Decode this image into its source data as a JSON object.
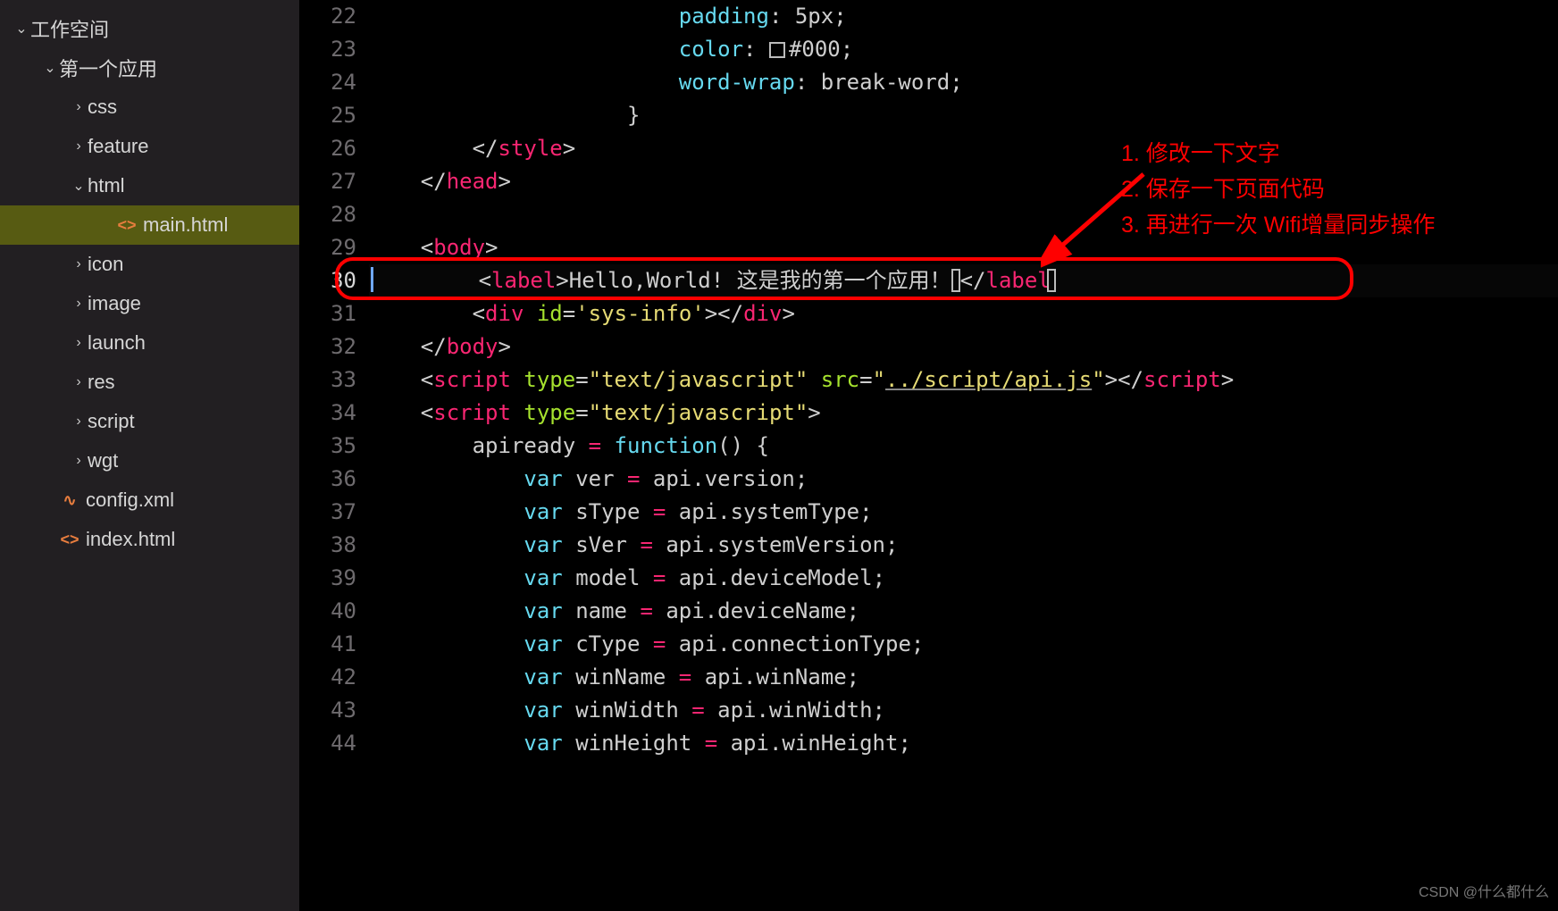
{
  "sidebar": {
    "root_label": "工作空间",
    "nodes": [
      {
        "label": "第一个应用",
        "depth": 1,
        "chev": "down",
        "icon": ""
      },
      {
        "label": "css",
        "depth": 2,
        "chev": "right",
        "icon": ""
      },
      {
        "label": "feature",
        "depth": 2,
        "chev": "right",
        "icon": ""
      },
      {
        "label": "html",
        "depth": 2,
        "chev": "down",
        "icon": ""
      },
      {
        "label": "main.html",
        "depth": 3,
        "chev": "",
        "icon": "code",
        "active": true
      },
      {
        "label": "icon",
        "depth": 2,
        "chev": "right",
        "icon": ""
      },
      {
        "label": "image",
        "depth": 2,
        "chev": "right",
        "icon": ""
      },
      {
        "label": "launch",
        "depth": 2,
        "chev": "right",
        "icon": ""
      },
      {
        "label": "res",
        "depth": 2,
        "chev": "right",
        "icon": ""
      },
      {
        "label": "script",
        "depth": 2,
        "chev": "right",
        "icon": ""
      },
      {
        "label": "wgt",
        "depth": 2,
        "chev": "right",
        "icon": ""
      },
      {
        "label": "config.xml",
        "depth": 1,
        "chev": "",
        "icon": "rss"
      },
      {
        "label": "index.html",
        "depth": 1,
        "chev": "",
        "icon": "code"
      }
    ]
  },
  "editor": {
    "first_line": 22,
    "current_line": 30,
    "lines": [
      {
        "n": 22,
        "ind": 6,
        "seg": [
          [
            "prop",
            "padding"
          ],
          [
            "pun",
            ": "
          ],
          [
            "val",
            "5px"
          ],
          [
            "pun",
            ";"
          ]
        ]
      },
      {
        "n": 23,
        "ind": 6,
        "seg": [
          [
            "prop",
            "color"
          ],
          [
            "pun",
            ": "
          ],
          [
            "swatch",
            ""
          ],
          [
            "val",
            "#000"
          ],
          [
            "pun",
            ";"
          ]
        ]
      },
      {
        "n": 24,
        "ind": 6,
        "seg": [
          [
            "prop",
            "word-wrap"
          ],
          [
            "pun",
            ": "
          ],
          [
            "val",
            "break-word"
          ],
          [
            "pun",
            ";"
          ]
        ]
      },
      {
        "n": 25,
        "ind": 5,
        "seg": [
          [
            "pun",
            "}"
          ]
        ]
      },
      {
        "n": 26,
        "ind": 2,
        "seg": [
          [
            "ang",
            "</"
          ],
          [
            "tag",
            "style"
          ],
          [
            "ang",
            ">"
          ]
        ]
      },
      {
        "n": 27,
        "ind": 1,
        "seg": [
          [
            "ang",
            "</"
          ],
          [
            "tag",
            "head"
          ],
          [
            "ang",
            ">"
          ]
        ]
      },
      {
        "n": 28,
        "ind": 0,
        "seg": []
      },
      {
        "n": 29,
        "ind": 1,
        "seg": [
          [
            "ang",
            "<"
          ],
          [
            "tag",
            "body"
          ],
          [
            "ang",
            ">"
          ]
        ]
      },
      {
        "n": 30,
        "ind": 2,
        "seg": [
          [
            "ang",
            "<"
          ],
          [
            "tag",
            "label"
          ],
          [
            "ang",
            ">"
          ],
          [
            "txt",
            "Hello,World! 这是我的第一个应用！"
          ],
          [
            "ghost",
            ""
          ],
          [
            "ang",
            "</"
          ],
          [
            "tag",
            "label"
          ],
          [
            "ghost2",
            ""
          ]
        ]
      },
      {
        "n": 31,
        "ind": 2,
        "seg": [
          [
            "ang",
            "<"
          ],
          [
            "tag",
            "div"
          ],
          [
            "pun",
            " "
          ],
          [
            "attr",
            "id"
          ],
          [
            "pun",
            "="
          ],
          [
            "str",
            "'sys-info'"
          ],
          [
            "ang",
            "></"
          ],
          [
            "tag",
            "div"
          ],
          [
            "ang",
            ">"
          ]
        ]
      },
      {
        "n": 32,
        "ind": 1,
        "seg": [
          [
            "ang",
            "</"
          ],
          [
            "tag",
            "body"
          ],
          [
            "ang",
            ">"
          ]
        ]
      },
      {
        "n": 33,
        "ind": 1,
        "seg": [
          [
            "ang",
            "<"
          ],
          [
            "tag",
            "script"
          ],
          [
            "pun",
            " "
          ],
          [
            "attr",
            "type"
          ],
          [
            "pun",
            "="
          ],
          [
            "str",
            "\"text/javascript\""
          ],
          [
            "pun",
            " "
          ],
          [
            "attr",
            "src"
          ],
          [
            "pun",
            "="
          ],
          [
            "srcq",
            "\""
          ],
          [
            "src",
            "../script/api.js"
          ],
          [
            "srcq",
            "\""
          ],
          [
            "ang",
            "></"
          ],
          [
            "tag",
            "script"
          ],
          [
            "ang",
            ">"
          ]
        ]
      },
      {
        "n": 34,
        "ind": 1,
        "seg": [
          [
            "ang",
            "<"
          ],
          [
            "tag",
            "script"
          ],
          [
            "pun",
            " "
          ],
          [
            "attr",
            "type"
          ],
          [
            "pun",
            "="
          ],
          [
            "str",
            "\"text/javascript\""
          ],
          [
            "ang",
            ">"
          ]
        ]
      },
      {
        "n": 35,
        "ind": 2,
        "seg": [
          [
            "id",
            "apiready "
          ],
          [
            "op",
            "="
          ],
          [
            "pun",
            " "
          ],
          [
            "kw",
            "function"
          ],
          [
            "pun",
            "() {"
          ]
        ]
      },
      {
        "n": 36,
        "ind": 3,
        "seg": [
          [
            "kw",
            "var"
          ],
          [
            "pun",
            " "
          ],
          [
            "id",
            "ver "
          ],
          [
            "op",
            "="
          ],
          [
            "pun",
            " api."
          ],
          [
            "id",
            "version"
          ],
          [
            "pun",
            ";"
          ]
        ]
      },
      {
        "n": 37,
        "ind": 3,
        "seg": [
          [
            "kw",
            "var"
          ],
          [
            "pun",
            " "
          ],
          [
            "id",
            "sType "
          ],
          [
            "op",
            "="
          ],
          [
            "pun",
            " api."
          ],
          [
            "id",
            "systemType"
          ],
          [
            "pun",
            ";"
          ]
        ]
      },
      {
        "n": 38,
        "ind": 3,
        "seg": [
          [
            "kw",
            "var"
          ],
          [
            "pun",
            " "
          ],
          [
            "id",
            "sVer "
          ],
          [
            "op",
            "="
          ],
          [
            "pun",
            " api."
          ],
          [
            "id",
            "systemVersion"
          ],
          [
            "pun",
            ";"
          ]
        ]
      },
      {
        "n": 39,
        "ind": 3,
        "seg": [
          [
            "kw",
            "var"
          ],
          [
            "pun",
            " "
          ],
          [
            "id",
            "model "
          ],
          [
            "op",
            "="
          ],
          [
            "pun",
            " api."
          ],
          [
            "id",
            "deviceModel"
          ],
          [
            "pun",
            ";"
          ]
        ]
      },
      {
        "n": 40,
        "ind": 3,
        "seg": [
          [
            "kw",
            "var"
          ],
          [
            "pun",
            " "
          ],
          [
            "id",
            "name "
          ],
          [
            "op",
            "="
          ],
          [
            "pun",
            " api."
          ],
          [
            "id",
            "deviceName"
          ],
          [
            "pun",
            ";"
          ]
        ]
      },
      {
        "n": 41,
        "ind": 3,
        "seg": [
          [
            "kw",
            "var"
          ],
          [
            "pun",
            " "
          ],
          [
            "id",
            "cType "
          ],
          [
            "op",
            "="
          ],
          [
            "pun",
            " api."
          ],
          [
            "id",
            "connectionType"
          ],
          [
            "pun",
            ";"
          ]
        ]
      },
      {
        "n": 42,
        "ind": 3,
        "seg": [
          [
            "kw",
            "var"
          ],
          [
            "pun",
            " "
          ],
          [
            "id",
            "winName "
          ],
          [
            "op",
            "="
          ],
          [
            "pun",
            " api."
          ],
          [
            "id",
            "winName"
          ],
          [
            "pun",
            ";"
          ]
        ]
      },
      {
        "n": 43,
        "ind": 3,
        "seg": [
          [
            "kw",
            "var"
          ],
          [
            "pun",
            " "
          ],
          [
            "id",
            "winWidth "
          ],
          [
            "op",
            "="
          ],
          [
            "pun",
            " api."
          ],
          [
            "id",
            "winWidth"
          ],
          [
            "pun",
            ";"
          ]
        ]
      },
      {
        "n": 44,
        "ind": 3,
        "seg": [
          [
            "kw",
            "var"
          ],
          [
            "pun",
            " "
          ],
          [
            "id",
            "winHeight "
          ],
          [
            "op",
            "="
          ],
          [
            "pun",
            " api."
          ],
          [
            "id",
            "winHeight"
          ],
          [
            "pun",
            ";"
          ]
        ]
      }
    ]
  },
  "annotation": {
    "lines": [
      "1. 修改一下文字",
      "2. 保存一下页面代码",
      "3. 再进行一次 Wifi增量同步操作"
    ]
  },
  "watermark": "CSDN @什么都什么"
}
